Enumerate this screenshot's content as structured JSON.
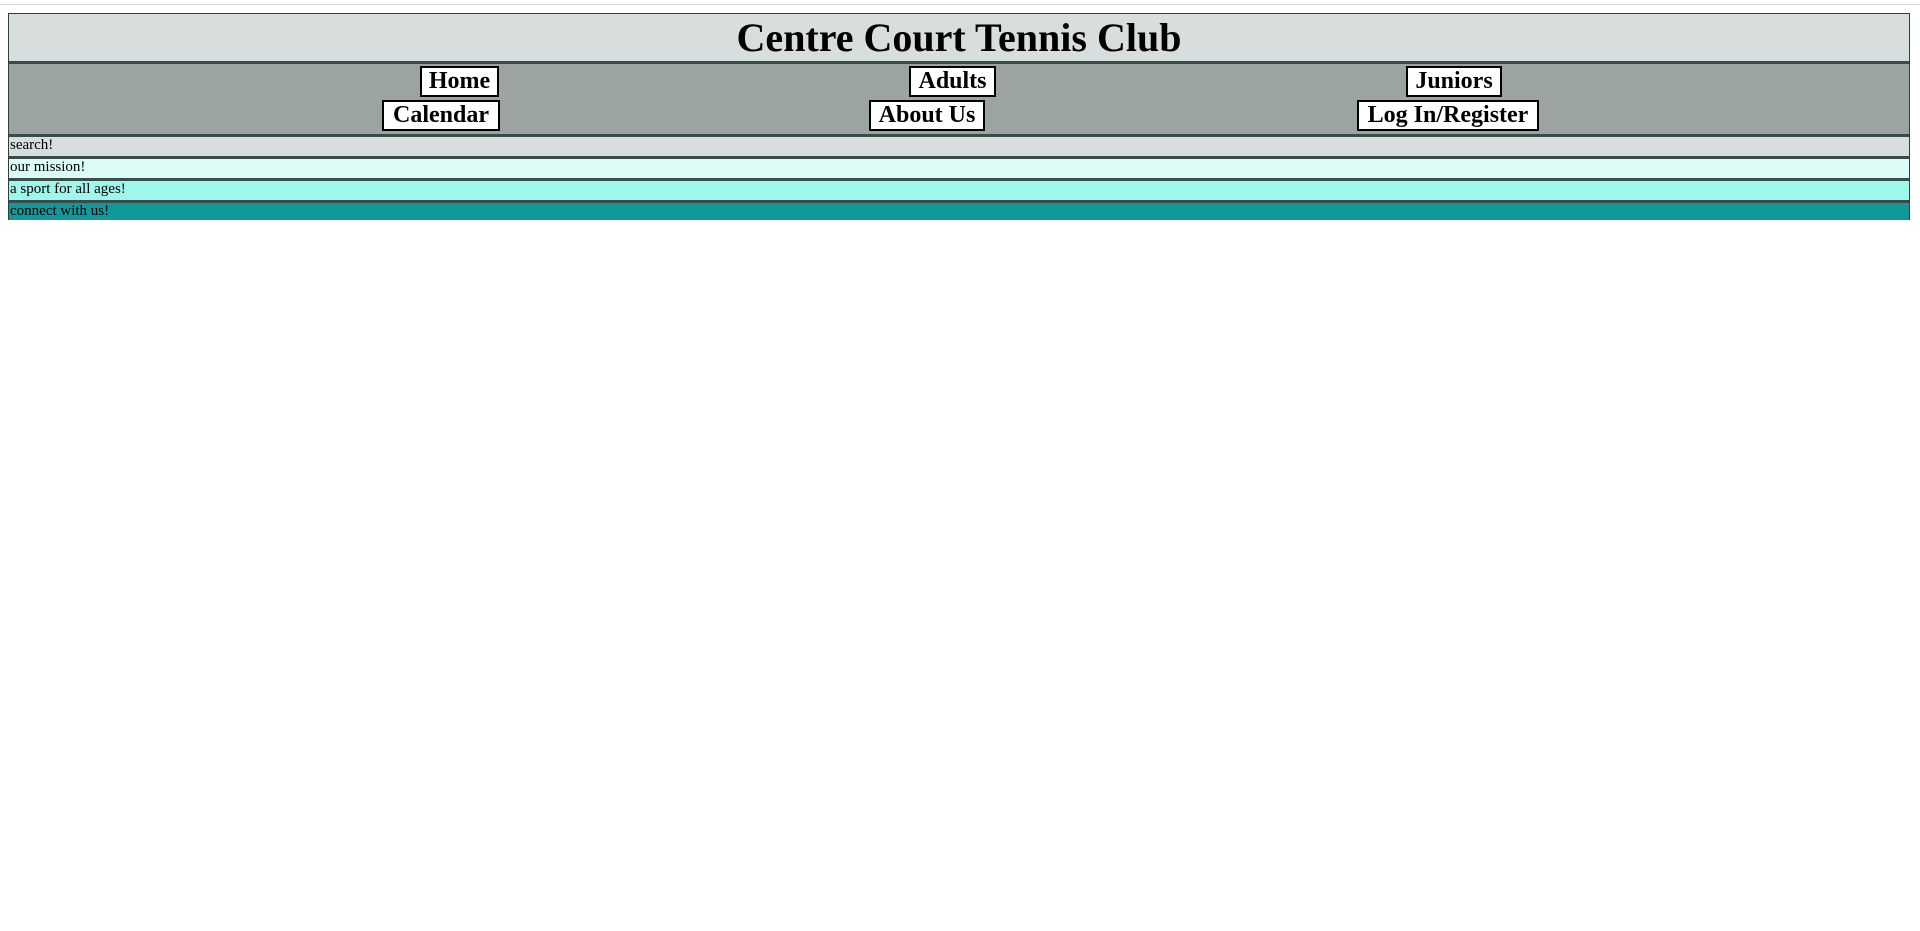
{
  "header": {
    "title": "Centre Court Tennis Club"
  },
  "nav": {
    "home": "Home",
    "adults": "Adults",
    "juniors": "Juniors",
    "calendar": "Calendar",
    "about": "About Us",
    "login": "Log In/Register"
  },
  "sections": {
    "search": "search!",
    "mission": "our mission!",
    "ages": "a sport for all ages!",
    "connect": "connect with us!"
  },
  "colors": {
    "title_bar": "#d8dddd",
    "nav_bar": "#9ca4a3",
    "border": "#3a4c49",
    "search_strip": "#d8dddd",
    "mission_strip": "#dcfcf8",
    "ages_strip": "#9ff6ea",
    "connect_strip": "#13989a"
  }
}
